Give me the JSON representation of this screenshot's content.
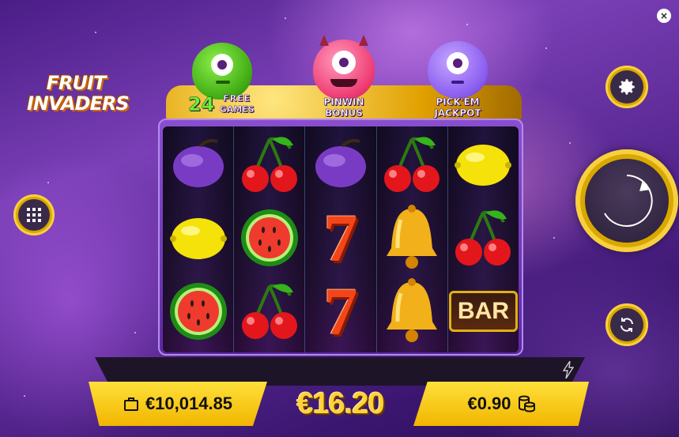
{
  "logo": {
    "line1": "FRUIT",
    "line2": "INVADERS"
  },
  "features": [
    {
      "number": "24",
      "line1": "FREE",
      "line2": "GAMES",
      "color": "#52d31f"
    },
    {
      "number": "",
      "line1": "PINWIN",
      "line2": "BONUS",
      "color": "#ff5d8e"
    },
    {
      "number": "",
      "line1": "PICK'EM",
      "line2": "JACKPOT",
      "color": "#9a6cff"
    }
  ],
  "reels": [
    [
      "plum",
      "lemon",
      "watermelon"
    ],
    [
      "cherry",
      "watermelon",
      "cherry"
    ],
    [
      "plum",
      "seven",
      "seven"
    ],
    [
      "cherry",
      "bell",
      "bell"
    ],
    [
      "lemon",
      "cherry",
      "bar"
    ]
  ],
  "bar_label": "BAR",
  "seven_label": "7",
  "balance": {
    "value": "€10,014.85",
    "icon": "wallet-icon"
  },
  "win": {
    "value": "€16.20"
  },
  "bet": {
    "value": "€0.90",
    "icon": "coins-icon"
  },
  "buttons": {
    "close": "×",
    "menu_icon": "grid-icon",
    "settings_icon": "gear-icon",
    "spin_icon": "spin-arrow-icon",
    "autoplay_icon": "refresh-icon",
    "turbo_icon": "lightning-icon"
  },
  "colors": {
    "accent": "#f1b600",
    "reel_bg": "#1a1031",
    "frame": "#8a4fd1"
  }
}
